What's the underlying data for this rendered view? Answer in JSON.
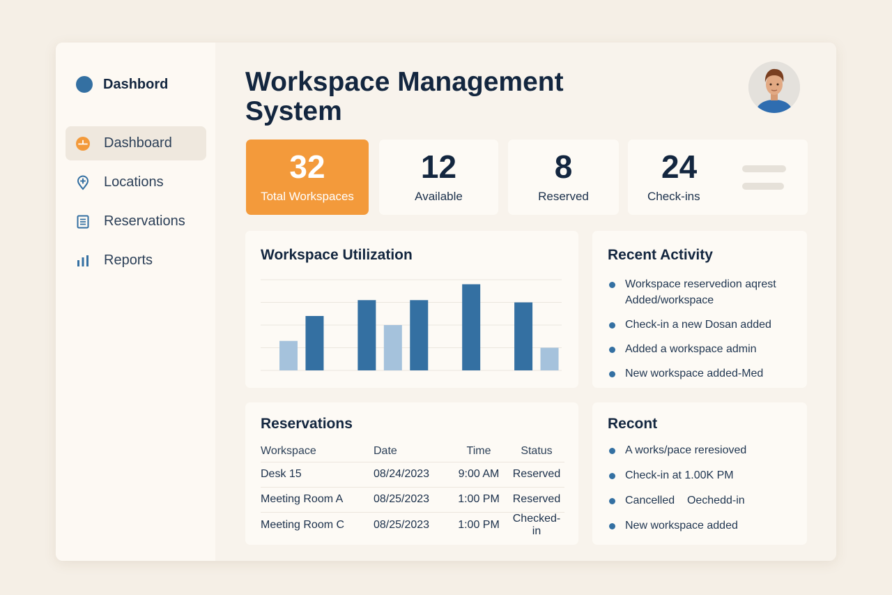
{
  "sidebar": {
    "brand": "Dashbord",
    "items": [
      {
        "label": "Dashboard",
        "icon": "dashboard-icon",
        "active": true
      },
      {
        "label": "Locations",
        "icon": "location-pin-icon",
        "active": false
      },
      {
        "label": "Reservations",
        "icon": "document-icon",
        "active": false
      },
      {
        "label": "Reports",
        "icon": "bar-chart-icon",
        "active": false
      }
    ]
  },
  "header": {
    "title_line1": "Workspace Management",
    "title_line2": "System"
  },
  "stats": [
    {
      "value": "32",
      "label": "Total Workspaces"
    },
    {
      "value": "12",
      "label": "Available"
    },
    {
      "value": "8",
      "label": "Reserved"
    },
    {
      "value": "24",
      "label": "Check-ins"
    }
  ],
  "utilization": {
    "title": "Workspace Utilization"
  },
  "chart_data": {
    "type": "bar",
    "title": "Workspace Utilization",
    "series": [
      {
        "values": [
          1.3,
          2.4,
          0,
          3.1,
          2.0,
          3.1,
          0,
          3.8,
          0,
          3.0,
          1.0
        ],
        "kinds": [
          "light",
          "dark",
          "gap",
          "dark",
          "light",
          "dark",
          "gap",
          "dark",
          "gap",
          "dark",
          "light"
        ]
      }
    ],
    "ylim": [
      0,
      4
    ],
    "grid": true,
    "colors": {
      "dark": "#3470a2",
      "light": "#a5c2dc"
    }
  },
  "recent_activity": {
    "title": "Recent Activity",
    "items": [
      "Workspace reservedion aqrest Added/workspace",
      "Check-in a new Dosan added",
      "Added a workspace admin",
      "New workspace added-Med"
    ]
  },
  "reservations": {
    "title": "Reservations",
    "columns": [
      "Workspace",
      "Date",
      "Time",
      "Status"
    ],
    "rows": [
      [
        "Desk 15",
        "08/24/2023",
        "9:00 AM",
        "Reserved"
      ],
      [
        "Meeting Room A",
        "08/25/2023",
        "1:00 PM",
        "Reserved"
      ],
      [
        "Meeting Room C",
        "08/25/2023",
        "1:00 PM",
        "Checked-in"
      ]
    ]
  },
  "recent": {
    "title": "Recont",
    "items": [
      "A works/pace reresioved",
      "Check-in at 1.00K PM",
      "Cancelled    Oechedd-in",
      "New workspace added"
    ]
  },
  "colors": {
    "accent": "#f39a3b",
    "primary": "#3470a2",
    "text": "#13263f",
    "background": "#f5efe6"
  }
}
